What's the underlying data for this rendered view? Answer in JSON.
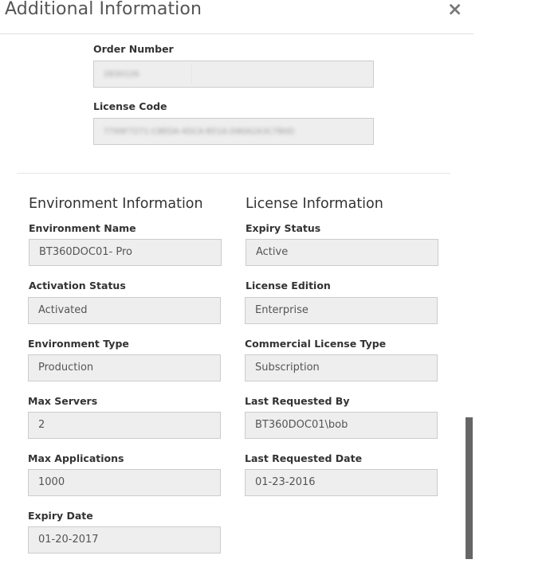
{
  "dialog": {
    "title": "Additional Information",
    "close_label": "×"
  },
  "order": {
    "order_number_label": "Order Number",
    "order_number_value": "2830126",
    "license_code_label": "License Code",
    "license_code_value": "7799F7271-C8EDA-4DCA-B51A-D80A2A3C7B0D"
  },
  "environment": {
    "heading": "Environment Information",
    "fields": [
      {
        "label": "Environment Name",
        "value": "BT360DOC01- Pro"
      },
      {
        "label": "Activation Status",
        "value": "Activated"
      },
      {
        "label": "Environment Type",
        "value": "Production"
      },
      {
        "label": "Max Servers",
        "value": "2"
      },
      {
        "label": "Max Applications",
        "value": "1000"
      },
      {
        "label": "Expiry Date",
        "value": "01-20-2017"
      }
    ]
  },
  "license": {
    "heading": "License Information",
    "fields": [
      {
        "label": "Expiry Status",
        "value": "Active"
      },
      {
        "label": "License Edition",
        "value": "Enterprise"
      },
      {
        "label": "Commercial License Type",
        "value": "Subscription"
      },
      {
        "label": "Last Requested By",
        "value": "BT360DOC01\\bob"
      },
      {
        "label": "Last Requested Date",
        "value": "01-23-2016"
      }
    ]
  },
  "colors": {
    "input_bg": "#eeeeee",
    "input_border": "#cccccc",
    "scrollbar": "#666666"
  }
}
